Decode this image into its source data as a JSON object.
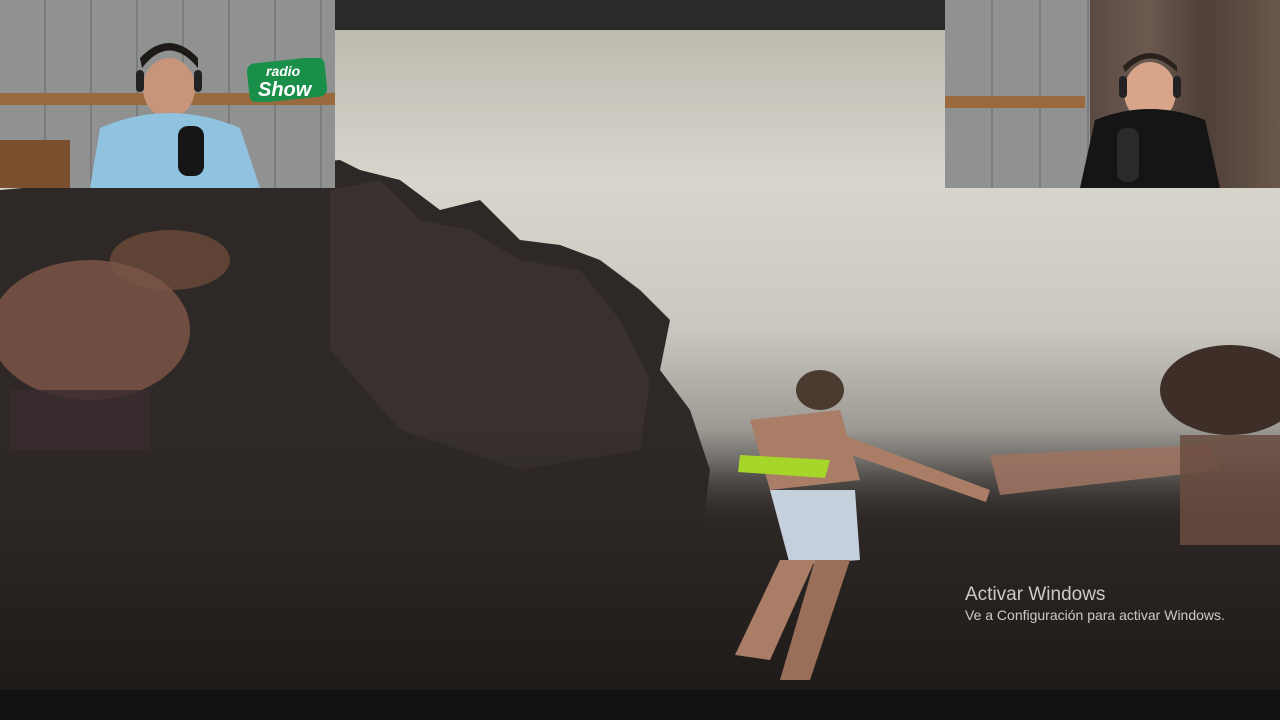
{
  "logo": {
    "line1": "radio",
    "line2": "Show"
  },
  "watermark": {
    "title": "Activar Windows",
    "subtitle": "Ve a Configuración para activar Windows."
  },
  "colors": {
    "sky": "#d8d6cc",
    "sand": "#2b2624",
    "logo_green": "#1a8f4a",
    "bikini": "#a6d62a",
    "left_shirt": "#8fc3e0",
    "right_shirt": "#151515"
  }
}
